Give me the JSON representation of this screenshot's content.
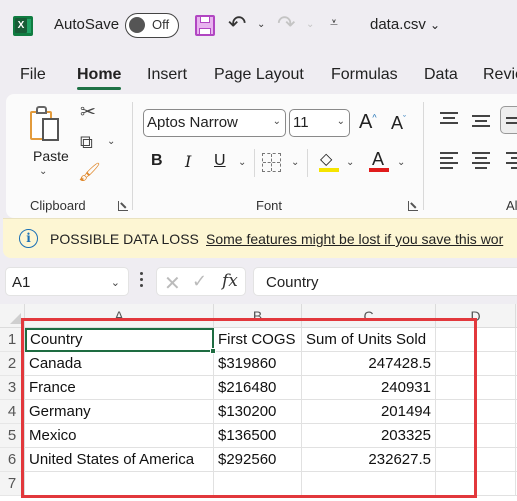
{
  "titlebar": {
    "app_icon": "excel-logo-icon",
    "app_icon_letter": "X",
    "autosave_label": "AutoSave",
    "autosave_state": "Off",
    "save_icon": "save-icon",
    "undo_icon": "undo-icon",
    "redo_icon": "redo-icon",
    "customize_icon": "customize-quick-access-icon",
    "filename": "data.csv",
    "filename_chevron": "⌄"
  },
  "tabs": [
    {
      "label": "File",
      "active": false
    },
    {
      "label": "Home",
      "active": true
    },
    {
      "label": "Insert",
      "active": false
    },
    {
      "label": "Page Layout",
      "active": false
    },
    {
      "label": "Formulas",
      "active": false
    },
    {
      "label": "Data",
      "active": false
    },
    {
      "label": "Revie",
      "active": false
    }
  ],
  "ribbon": {
    "clipboard": {
      "paste_label": "Paste",
      "group_label": "Clipboard",
      "icons": [
        "paste-icon",
        "cut-icon",
        "copy-icon",
        "format-painter-icon"
      ]
    },
    "font": {
      "font_name": "Aptos Narrow",
      "font_size": "11",
      "increase_size": "A",
      "decrease_size": "A",
      "bold": "B",
      "italic": "I",
      "underline": "U",
      "font_color_letter": "A",
      "highlight_color": "#f5e400",
      "font_color": "#e01b1b",
      "group_label": "Font"
    },
    "alignment": {
      "group_label": "Al"
    }
  },
  "warning": {
    "title": "POSSIBLE DATA LOSS",
    "message": "Some features might be lost if you save this wor"
  },
  "formula_bar": {
    "name_box": "A1",
    "cancel": "✕",
    "enter": "✓",
    "fx": "fx",
    "content": "Country"
  },
  "sheet": {
    "columns": [
      "A",
      "B",
      "C",
      "D"
    ],
    "row_numbers": [
      "1",
      "2",
      "3",
      "4",
      "5",
      "6",
      "7"
    ],
    "rows": [
      [
        "Country",
        "First COGS",
        "Sum of Units Sold",
        ""
      ],
      [
        "Canada",
        "$319860",
        "247428.5",
        ""
      ],
      [
        "France",
        "$216480",
        "240931",
        ""
      ],
      [
        "Germany",
        "$130200",
        "201494",
        ""
      ],
      [
        "Mexico",
        "$136500",
        "203325",
        ""
      ],
      [
        "United States of America",
        "$292560",
        "232627.5",
        ""
      ],
      [
        "",
        "",
        "",
        ""
      ]
    ],
    "active_cell": "A1",
    "highlight_color": "#e2383c"
  }
}
